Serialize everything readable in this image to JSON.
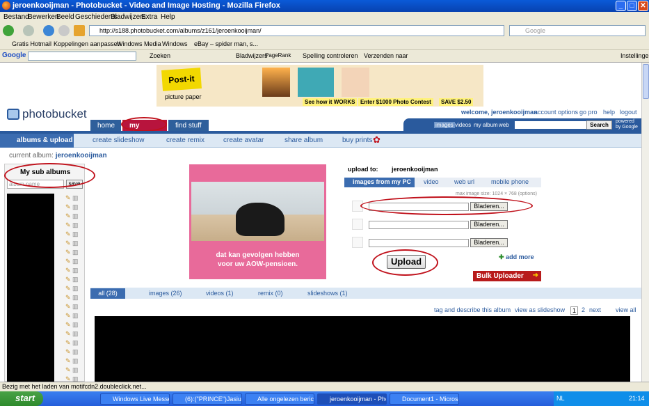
{
  "window": {
    "title": "jeroenkooijman - Photobucket - Video and Image Hosting - Mozilla Firefox"
  },
  "menu": [
    "Bestand",
    "Bewerken",
    "Beeld",
    "Geschiedenis",
    "Bladwijzers",
    "Extra",
    "Help"
  ],
  "nav": {
    "url": "http://s188.photobucket.com/albums/z161/jeroenkooijman/",
    "search_placeholder": "Google"
  },
  "bookmarks": [
    "Gratis Hotmail",
    "Koppelingen aanpassen",
    "Windows Media",
    "Windows",
    "eBay – spider man, s..."
  ],
  "gtoolbar": {
    "logo": "Google",
    "zoeken": "Zoeken",
    "bladwijzers": "Bladwijzers",
    "pagerank": "PageRank",
    "spelling": "Spelling controleren",
    "verzenden": "Verzenden naar",
    "instellingen": "Instellingen"
  },
  "ad": {
    "brand": "Post-it",
    "sub": "picture paper",
    "cta1": "See how it WORKS",
    "cta2": "Enter $1000 Photo Contest",
    "cta3": "SAVE $2.50"
  },
  "pb": {
    "logo": "photobucket",
    "tabs": [
      "home",
      "my album",
      "find stuff"
    ],
    "welcome": "welcome, jeroenkooijman",
    "links": [
      "account options",
      "go pro",
      "help",
      "logout"
    ],
    "search_scopes": [
      "images",
      "videos",
      "my album",
      "web"
    ],
    "search_btn": "Search",
    "powered": "powered by Google",
    "subnav": [
      "albums & upload",
      "create slideshow",
      "create remix",
      "create avatar",
      "share album",
      "buy prints"
    ],
    "current_album_label": "current album:",
    "current_album": "jeroenkooijman"
  },
  "sidebar": {
    "title": "My sub albums",
    "placeholder": "album name",
    "save": "save"
  },
  "promo": {
    "text1": "dat kan gevolgen hebben",
    "text2": "voor uw AOW-pensioen."
  },
  "upload": {
    "to_label": "upload to:",
    "album": "jeroenkooijman",
    "tabs": [
      "images from my PC",
      "video",
      "web url",
      "mobile phone"
    ],
    "max_size": "max image size: 1024 × 768 (options)",
    "browse": "Bladeren...",
    "add_more": "add more",
    "button": "Upload",
    "bulk": "Bulk Uploader"
  },
  "media_tabs": [
    "all (28)",
    "images (26)",
    "videos (1)",
    "remix (0)",
    "slideshows (1)"
  ],
  "tagrow": {
    "tag": "tag and describe this album",
    "slideshow": "view as slideshow",
    "pages": [
      "1",
      "2"
    ],
    "next": "next",
    "viewall": "view all"
  },
  "status": "Bezig met het laden van motifcdn2.doubleclick.net...",
  "taskbar": {
    "start": "start",
    "tasks": [
      "Windows Live Messen...",
      "(6):(\"PRINCE\")Jasiu K...",
      "Alle ongelezen berich...",
      "jeroenkooijman - Pho...",
      "Document1 - Microsof..."
    ],
    "lang": "NL",
    "clock": "21:14"
  }
}
